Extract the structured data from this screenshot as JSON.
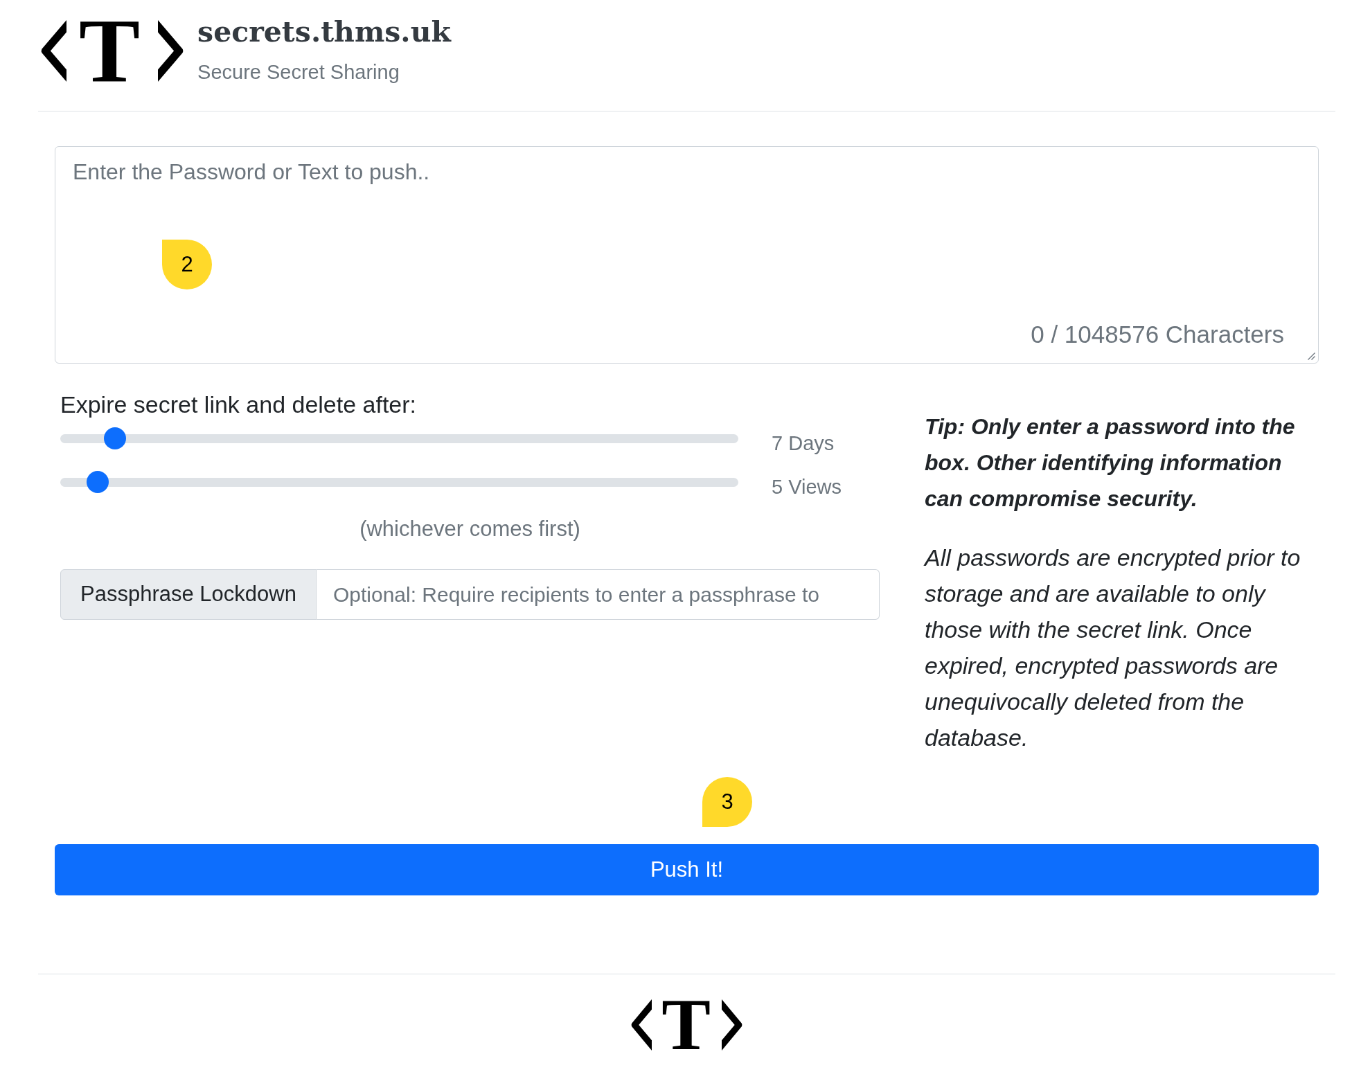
{
  "header": {
    "logo": {
      "letter": "T"
    },
    "title": "secrets.thms.uk",
    "subtitle": "Secure Secret Sharing"
  },
  "secret_input": {
    "placeholder": "Enter the Password or Text to push..",
    "counter": "0 / 1048576 Characters"
  },
  "expiry": {
    "label": "Expire secret link and delete after:",
    "sliders": [
      {
        "level": 0.067,
        "reading": "7 Days"
      },
      {
        "level": 0.04,
        "reading": "5 Views"
      }
    ],
    "note": "(whichever comes first)"
  },
  "passphrase": {
    "label": "Passphrase Lockdown",
    "placeholder": "Optional: Require recipients to enter a passphrase to"
  },
  "tips": [
    {
      "kind": "tip",
      "text": "Tip: Only enter a password into the box. Other identifying information can compromise security."
    },
    {
      "kind": "info",
      "text": "All passwords are encrypted prior to storage and are available to only those with the secret link. Once expired, encrypted passwords are unequivocally deleted from the database."
    }
  ],
  "push_button": {
    "label": "Push It!"
  },
  "footer": {
    "logo": {
      "letter": "T"
    }
  },
  "callouts": [
    {
      "label": "2",
      "kind": "tail_up"
    },
    {
      "label": "3",
      "kind": "tail_down"
    }
  ]
}
